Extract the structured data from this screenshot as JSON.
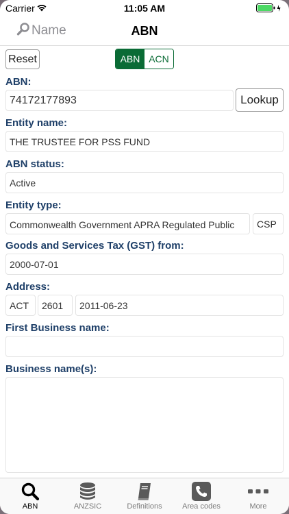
{
  "status_bar": {
    "carrier": "Carrier",
    "time": "11:05 AM"
  },
  "nav": {
    "left_label": "Name",
    "title": "ABN"
  },
  "controls": {
    "reset_label": "Reset",
    "segment_options": [
      "ABN",
      "ACN"
    ],
    "segment_selected": "ABN"
  },
  "abn": {
    "label": "ABN:",
    "value": "74172177893",
    "lookup_label": "Lookup"
  },
  "entity_name": {
    "label": "Entity name:",
    "value": "THE TRUSTEE FOR PSS FUND"
  },
  "abn_status": {
    "label": "ABN status:",
    "value": "Active"
  },
  "entity_type": {
    "label": "Entity type:",
    "value": "Commonwealth Government APRA Regulated Public Sector Scheme",
    "code": "CSP"
  },
  "gst": {
    "label": "Goods and Services Tax (GST) from:",
    "value": "2000-07-01"
  },
  "address": {
    "label": "Address:",
    "state": "ACT",
    "postcode": "2601",
    "date": "2011-06-23"
  },
  "first_business_name": {
    "label": "First Business name:",
    "value": ""
  },
  "business_names": {
    "label": "Business name(s):"
  },
  "tabs": [
    {
      "label": "ABN",
      "icon": "search-icon",
      "active": true
    },
    {
      "label": "ANZSIC",
      "icon": "database-icon",
      "active": false
    },
    {
      "label": "Definitions",
      "icon": "book-icon",
      "active": false
    },
    {
      "label": "Area codes",
      "icon": "phone-icon",
      "active": false
    },
    {
      "label": "More",
      "icon": "more-icon",
      "active": false
    }
  ],
  "colors": {
    "accent_green": "#0a6b35",
    "label_blue": "#1e3f68",
    "battery_green": "#4cd964"
  }
}
